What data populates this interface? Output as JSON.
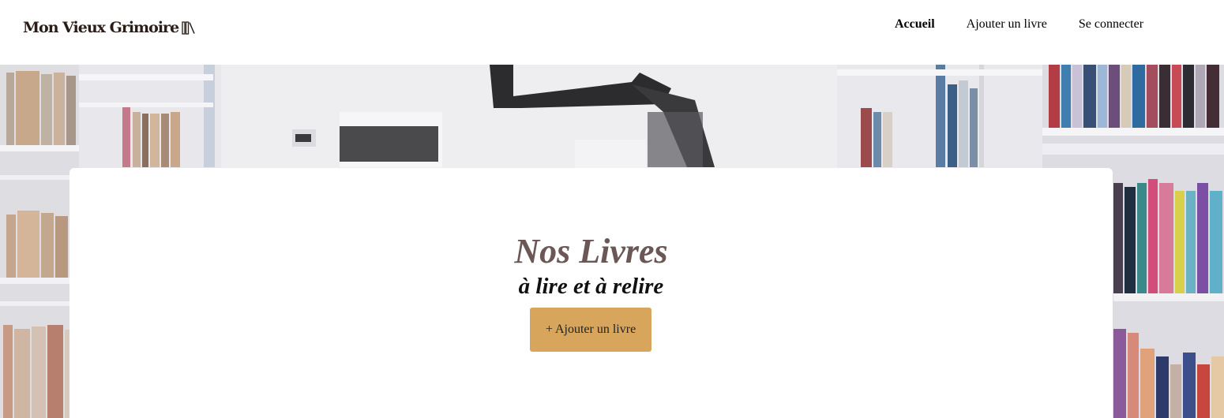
{
  "header": {
    "logo_text": "Mon Vieux Grimoire",
    "logo_icon": "books-icon",
    "nav": [
      {
        "label": "Accueil",
        "active": true
      },
      {
        "label": "Ajouter un livre",
        "active": false
      },
      {
        "label": "Se connecter",
        "active": false
      }
    ]
  },
  "hero": {
    "title": "Nos Livres",
    "subtitle": "à lire et à relire",
    "add_button_label": "+ Ajouter un livre"
  },
  "colors": {
    "title": "#6b5755",
    "button": "#d7a55c",
    "logo": "#2a1d17"
  }
}
